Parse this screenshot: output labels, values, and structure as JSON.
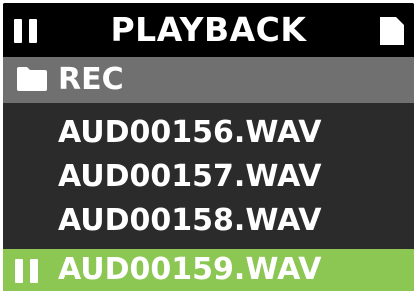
{
  "header": {
    "title": "PLAYBACK",
    "left_icon": "pause-icon",
    "right_icon": "file-icon"
  },
  "folder": {
    "icon": "folder-icon",
    "name": "REC"
  },
  "files": [
    {
      "name": "AUD00156.WAV",
      "selected": false
    },
    {
      "name": "AUD00157.WAV",
      "selected": false
    },
    {
      "name": "AUD00158.WAV",
      "selected": false
    },
    {
      "name": "AUD00159.WAV",
      "selected": true,
      "icon": "pause-icon"
    }
  ],
  "colors": {
    "header_bg": "#000000",
    "folder_bg": "#707070",
    "list_bg": "#2b2b2b",
    "selected_bg": "#8cc653",
    "text": "#ffffff"
  }
}
